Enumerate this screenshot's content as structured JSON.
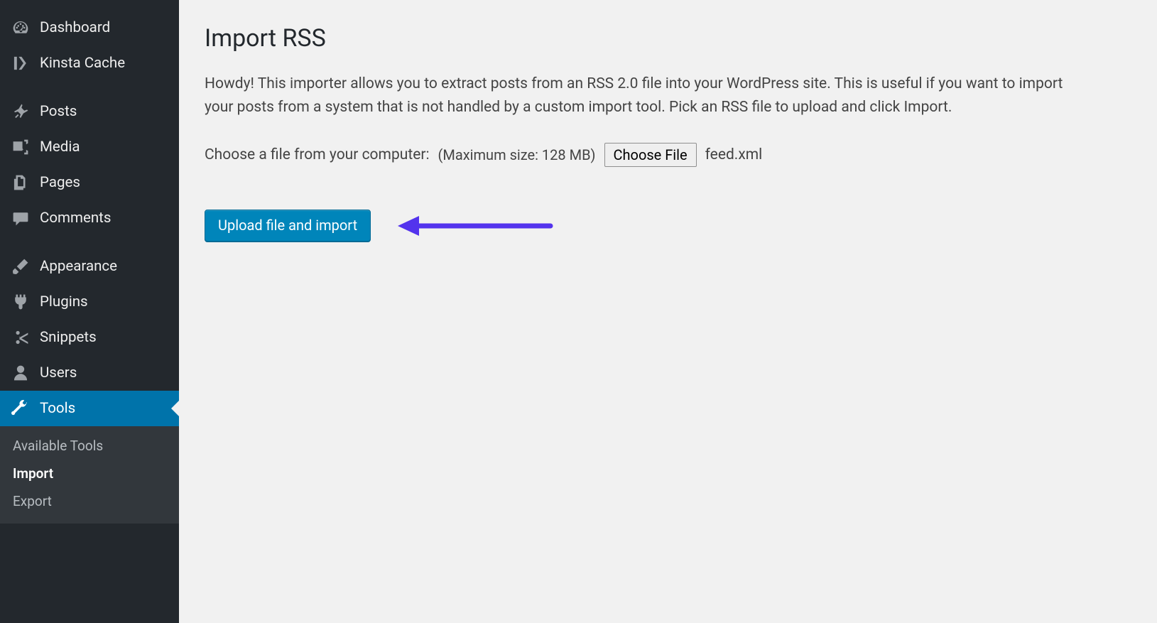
{
  "sidebar": {
    "items": [
      {
        "id": "dashboard",
        "label": "Dashboard",
        "icon": "dashboard-icon"
      },
      {
        "id": "kinsta",
        "label": "Kinsta Cache",
        "icon": "kinsta-icon"
      },
      {
        "id": "posts",
        "label": "Posts",
        "icon": "pin-icon",
        "sep_before": true
      },
      {
        "id": "media",
        "label": "Media",
        "icon": "media-icon"
      },
      {
        "id": "pages",
        "label": "Pages",
        "icon": "pages-icon"
      },
      {
        "id": "comments",
        "label": "Comments",
        "icon": "comments-icon"
      },
      {
        "id": "appearance",
        "label": "Appearance",
        "icon": "brush-icon",
        "sep_before": true
      },
      {
        "id": "plugins",
        "label": "Plugins",
        "icon": "plug-icon"
      },
      {
        "id": "snippets",
        "label": "Snippets",
        "icon": "scissors-icon"
      },
      {
        "id": "users",
        "label": "Users",
        "icon": "user-icon"
      },
      {
        "id": "tools",
        "label": "Tools",
        "icon": "wrench-icon",
        "current": true
      }
    ],
    "submenu": [
      {
        "id": "available-tools",
        "label": "Available Tools"
      },
      {
        "id": "import",
        "label": "Import",
        "current": true
      },
      {
        "id": "export",
        "label": "Export"
      }
    ]
  },
  "main": {
    "title": "Import RSS",
    "intro": "Howdy! This importer allows you to extract posts from an RSS 2.0 file into your WordPress site. This is useful if you want to import your posts from a system that is not handled by a custom import tool. Pick an RSS file to upload and click Import.",
    "choose_label": "Choose a file from your computer:",
    "max_size": "(Maximum size: 128 MB)",
    "choose_button": "Choose File",
    "selected_file": "feed.xml",
    "upload_button": "Upload file and import"
  },
  "annotation": {
    "arrow_color": "#5333ed"
  }
}
